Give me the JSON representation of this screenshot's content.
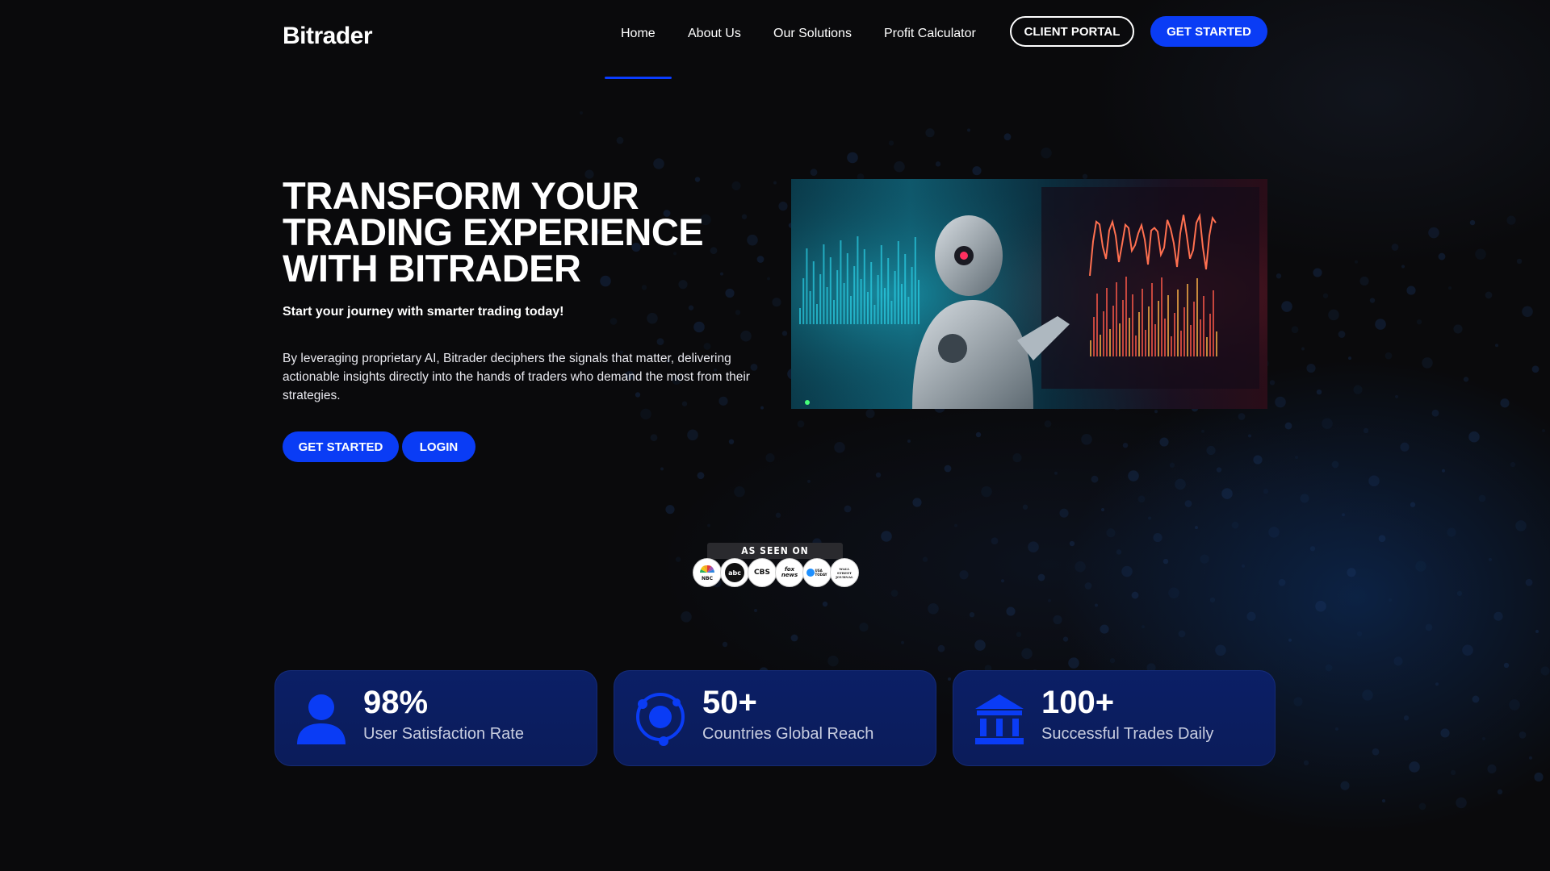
{
  "brand": {
    "name": "Bitrader"
  },
  "nav": {
    "items": [
      "Home",
      "About Us",
      "Our Solutions",
      "Profit Calculator"
    ],
    "active": "Home",
    "client_portal": "CLIENT PORTAL",
    "get_started": "GET STARTED"
  },
  "hero": {
    "title_lines": [
      "TRANSFORM YOUR",
      "TRADING EXPERIENCE",
      "WITH BITRADER"
    ],
    "subtitle": "Start your journey with smarter trading today!",
    "description": "By leveraging proprietary AI, Bitrader deciphers the signals that matter, delivering actionable insights directly into the hands of traders who demand the most from their strategies.",
    "primary_button": "GET STARTED",
    "secondary_button": "LOGIN"
  },
  "as_seen_on": {
    "label": "AS SEEN ON",
    "logos": [
      "NBC",
      "abc",
      "CBS",
      "fox news",
      "USA TODAY",
      "WALL STREET JOURNAL"
    ]
  },
  "stats": [
    {
      "icon": "user-icon",
      "value": "98%",
      "label": "User Satisfaction Rate"
    },
    {
      "icon": "globe-orbit-icon",
      "value": "50+",
      "label": "Countries Global Reach"
    },
    {
      "icon": "bank-icon",
      "value": "100+",
      "label": "Successful Trades Daily"
    }
  ],
  "colors": {
    "accent": "#0a3cf5",
    "background": "#0a0a0c",
    "card": "#0b1f66",
    "icon": "#0a3cf5"
  }
}
